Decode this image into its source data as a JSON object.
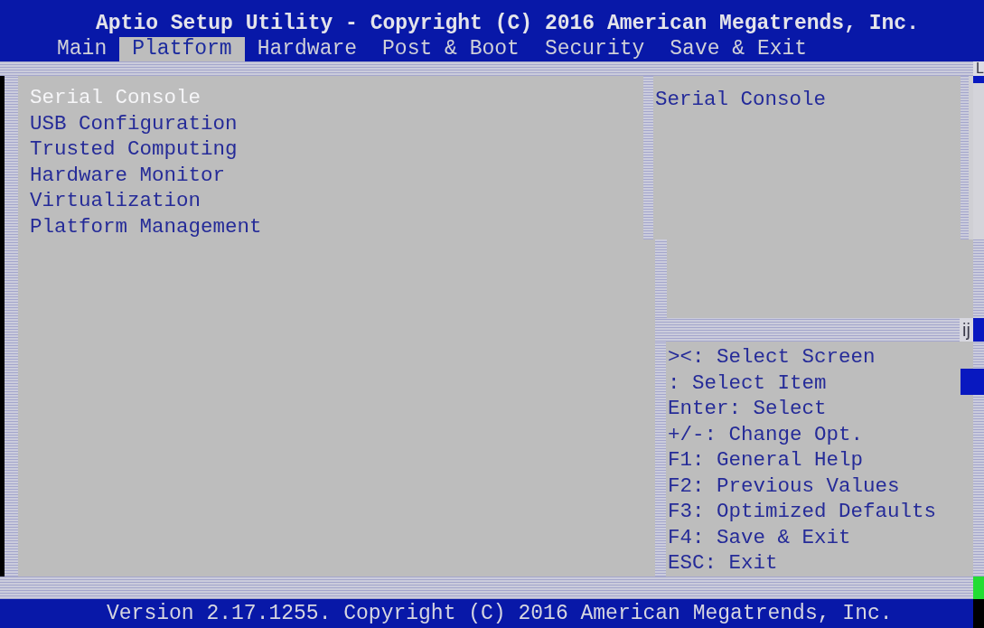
{
  "header": {
    "title": "Aptio Setup Utility - Copyright (C) 2016 American Megatrends, Inc."
  },
  "tabs": [
    {
      "label": "Main",
      "selected": false
    },
    {
      "label": "Platform",
      "selected": true
    },
    {
      "label": "Hardware",
      "selected": false
    },
    {
      "label": "Post & Boot",
      "selected": false
    },
    {
      "label": "Security",
      "selected": false
    },
    {
      "label": "Save & Exit",
      "selected": false
    }
  ],
  "menu": {
    "items": [
      {
        "label": "Serial Console",
        "selected": true
      },
      {
        "label": "USB Configuration",
        "selected": false
      },
      {
        "label": "Trusted Computing",
        "selected": false
      },
      {
        "label": "Hardware Monitor",
        "selected": false
      },
      {
        "label": "Virtualization",
        "selected": false
      },
      {
        "label": "Platform Management",
        "selected": false
      }
    ]
  },
  "help": {
    "description": "Serial Console",
    "keys": [
      "><: Select Screen",
      ": Select Item",
      "Enter: Select",
      "+/-: Change Opt.",
      "F1: General Help",
      "F2: Previous Values",
      "F3: Optimized Defaults",
      "F4: Save & Exit",
      "ESC: Exit"
    ]
  },
  "scrollbar": {
    "top_glyph": "L",
    "thumb_glyph": "ij"
  },
  "footer": {
    "version": "Version 2.17.1255. Copyright (C) 2016 American Megatrends, Inc."
  }
}
